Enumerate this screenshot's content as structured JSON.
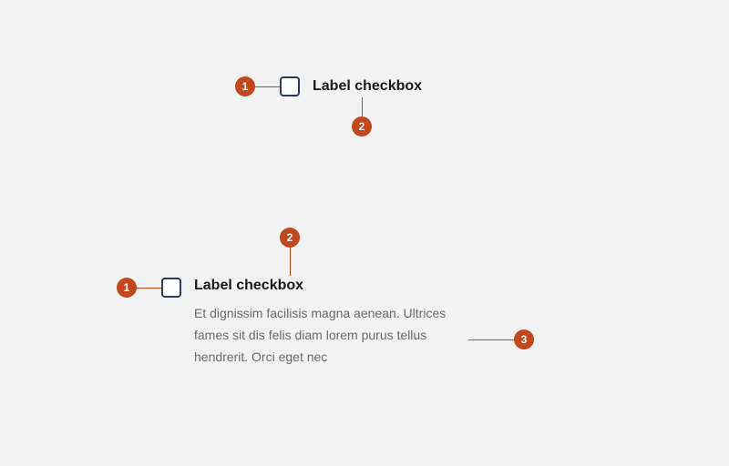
{
  "example1": {
    "label": "Label checkbox"
  },
  "example2": {
    "label": "Label checkbox",
    "helper": "Et dignissim facilisis magna aenean. Ultrices fames sit dis felis diam lorem purus tellus hendrerit. Orci eget nec"
  },
  "annotations": {
    "one": "1",
    "two": "2",
    "three": "3"
  }
}
